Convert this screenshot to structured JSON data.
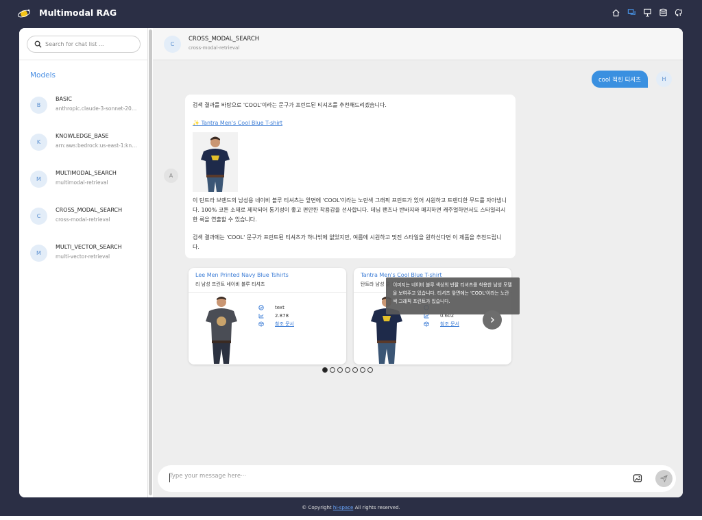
{
  "app": {
    "title": "Multimodal RAG"
  },
  "top_icons": [
    "home-icon",
    "chat-icon",
    "presentation-icon",
    "database-icon",
    "github-icon"
  ],
  "sidebar": {
    "search_placeholder": "Search for chat list ...",
    "models_title": "Models",
    "models": [
      {
        "avatar": "B",
        "name": "BASIC",
        "sub": "anthropic.claude-3-sonnet-20240229-v1:0"
      },
      {
        "avatar": "K",
        "name": "KNOWLEDGE_BASE",
        "sub": "arn:aws:bedrock:us-east-1:knowledge-base"
      },
      {
        "avatar": "M",
        "name": "MULTIMODAL_SEARCH",
        "sub": "multimodal-retrieval"
      },
      {
        "avatar": "C",
        "name": "CROSS_MODAL_SEARCH",
        "sub": "cross-modal-retrieval"
      },
      {
        "avatar": "M",
        "name": "MULTI_VECTOR_SEARCH",
        "sub": "multi-vector-retrieval"
      }
    ]
  },
  "chat": {
    "header": {
      "avatar": "C",
      "name": "CROSS_MODAL_SEARCH",
      "sub": "cross-modal-retrieval"
    },
    "user_message": "cool 적힌 티셔츠",
    "user_avatar": "H",
    "ai_avatar": "A",
    "ai_message": {
      "intro": "검색 결과를 바탕으로 'COOL'이라는 문구가 프린트된 티셔츠를 추천해드리겠습니다.",
      "link": "✨ Tantra Men's Cool Blue T-shirt",
      "para1": "이 탄트라 브랜드의 남성용 네이비 블루 티셔츠는 앞면에 'COOL'이라는 노란색 그래픽 프린트가 있어 시원하고 트렌디한 무드를 자아냅니다. 100% 코튼 소재로 제작되어 통기성이 좋고 편안한 착용감을 선사합니다. 데님 팬츠나 반바지와 매치하면 캐주얼하면서도 스타일리시한 룩을 연출할 수 있습니다.",
      "para2": "검색 결과에는 'COOL' 문구가 프린트된 티셔츠가 하나밖에 없었지만, 여름에 시원하고 멋진 스타일을 원하신다면 이 제품을 추천드립니다."
    },
    "products": [
      {
        "title": "Lee Men Printed Navy Blue Tshirts",
        "sub": "리 남성 프린트 네이비 블루 티셔츠",
        "type": "text",
        "score": "2.878",
        "ref": "참조 문서"
      },
      {
        "title": "Tantra Men's Cool Blue T-shirt",
        "sub": "탄트라 남성 쿨 블루 티셔츠",
        "type": "",
        "score": "0.602",
        "ref": "참조 문서"
      }
    ],
    "tooltip": "이미지는 네이비 블루 색상의 반팔 티셔츠를 착용한 남성 모델을 보여주고 있습니다. 티셔츠 앞면에는 'COOL'이라는 노란색 그래픽 프린트가 있습니다.",
    "carousel_pages": 7,
    "carousel_active": 0,
    "input_placeholder": "Type your message here···"
  },
  "footer": {
    "prefix": "© Copyright",
    "link": "hi-space",
    "suffix": "All rights reserved."
  },
  "colors": {
    "background": "#2b2f45",
    "accent": "#3a90e0",
    "link": "#3a7bd5"
  }
}
